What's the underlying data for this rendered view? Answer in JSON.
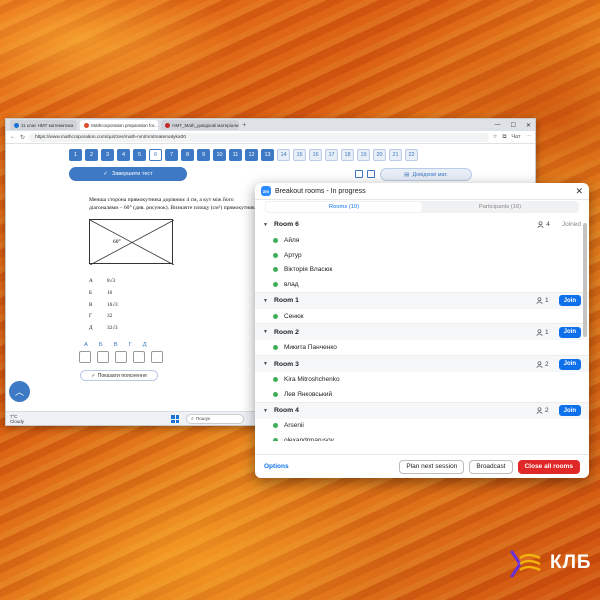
{
  "browser": {
    "tabs": [
      {
        "label": "11 клас НМТ математика",
        "icon": "tab-page-icon"
      },
      {
        "label": "Mathcorporation preparation for...",
        "icon": "tab-page-icon"
      },
      {
        "label": "НМТ_Math_довідкові матеріали",
        "icon": "pdf-icon"
      }
    ],
    "new_tab": "+",
    "window_controls": [
      "—",
      "☐",
      "✕"
    ],
    "url": "https://www.mathcorporation.com/quizzes/math-nmt/nmtmatematyka00",
    "profile_label": "Чат"
  },
  "quiz": {
    "question_numbers": [
      "1",
      "2",
      "3",
      "4",
      "5",
      "6",
      "7",
      "8",
      "9",
      "10",
      "11",
      "12",
      "13",
      "14",
      "15",
      "16",
      "17",
      "18",
      "19",
      "20",
      "21",
      "22"
    ],
    "current": "6",
    "finish_label": "Завершити тест",
    "reference_label": "Довідкові мат.",
    "question_text": "Менша сторона прямокутника дорівнює 4 см, а кут між його діагоналями – 60° (див. рисунок). Визначте площу (см²) прямокутника.",
    "figure_angle": "60°",
    "answers": [
      {
        "letter": "А",
        "value": "8√3"
      },
      {
        "letter": "Б",
        "value": "16"
      },
      {
        "letter": "В",
        "value": "16√3"
      },
      {
        "letter": "Г",
        "value": "32"
      },
      {
        "letter": "Д",
        "value": "32√3"
      }
    ],
    "grid_letters": [
      "А",
      "Б",
      "В",
      "Г",
      "Д"
    ],
    "explain_label": "Показати пояснення"
  },
  "taskbar": {
    "weather_temp": "7°C",
    "weather_desc": "Cloudy",
    "search_placeholder": "Пошук"
  },
  "breakout": {
    "title": "Breakout rooms - In progress",
    "tabs": {
      "rooms": "Rooms (10)",
      "participants": "Participants (16)"
    },
    "active_tab": "rooms",
    "join_label": "Join",
    "joined_label": "Joined",
    "rooms": [
      {
        "name": "Room 6",
        "count": "4",
        "joined": true,
        "participants": [
          "Айля",
          "Артур",
          "Вікторія Власюк",
          "влад"
        ]
      },
      {
        "name": "Room 1",
        "count": "1",
        "joined": false,
        "participants": [
          "Сенюк"
        ]
      },
      {
        "name": "Room 2",
        "count": "1",
        "joined": false,
        "participants": [
          "Микита Панченко"
        ]
      },
      {
        "name": "Room 3",
        "count": "2",
        "joined": false,
        "participants": [
          "Kira Mitroshchenko",
          "Лев Янковський"
        ]
      },
      {
        "name": "Room 4",
        "count": "2",
        "joined": false,
        "participants": [
          "Arsenii",
          "olexandrmarusov"
        ]
      }
    ],
    "footer": {
      "options": "Options",
      "plan": "Plan next session",
      "broadcast": "Broadcast",
      "close_all": "Close all rooms"
    },
    "accent_color": "#0e71eb",
    "danger_color": "#e02828",
    "online_color": "#3fae5a"
  },
  "brand": {
    "text": "КЛБ",
    "accent_colors": [
      "#6b2fd6",
      "#f2b10c"
    ]
  }
}
